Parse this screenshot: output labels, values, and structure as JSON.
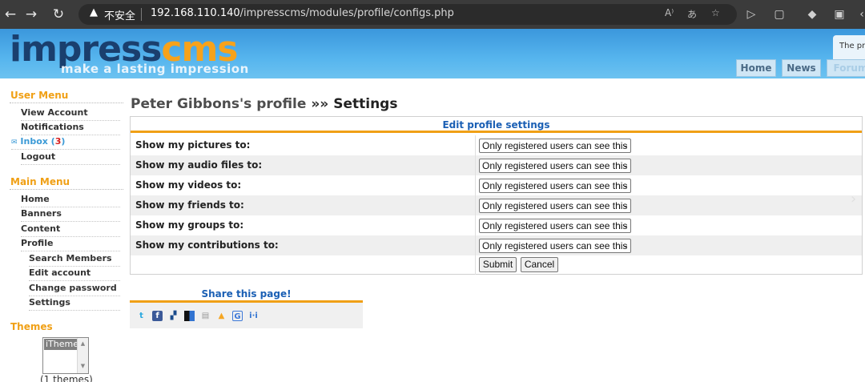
{
  "browser": {
    "security_warning": "不安全",
    "url_host": "192.168.110.140",
    "url_path": "/impresscms/modules/profile/configs.php"
  },
  "header": {
    "logo_part1": "impress",
    "logo_part2": "cms",
    "tagline": "make a lasting impression",
    "tooltip": "The pro",
    "nav_tabs": [
      "Home",
      "News",
      "Forum"
    ]
  },
  "sidebar": {
    "user_menu_title": "User Menu",
    "user_menu": [
      {
        "label": "View Account"
      },
      {
        "label": "Notifications"
      },
      {
        "label": "Inbox",
        "count": "3"
      },
      {
        "label": "Logout"
      }
    ],
    "main_menu_title": "Main Menu",
    "main_menu": [
      {
        "label": "Home"
      },
      {
        "label": "Banners"
      },
      {
        "label": "Content"
      },
      {
        "label": "Profile"
      },
      {
        "label": "Search Members"
      },
      {
        "label": "Edit account"
      },
      {
        "label": "Change password"
      },
      {
        "label": "Settings"
      }
    ],
    "themes_title": "Themes",
    "theme_selected": "iTheme",
    "themes_count": "(1 themes)"
  },
  "main": {
    "title_profile": "Peter Gibbons's profile",
    "title_sep": "»»",
    "title_current": "Settings",
    "table_header": "Edit profile settings",
    "rows": [
      {
        "label": "Show my pictures to:",
        "value": "Only registered users can see this"
      },
      {
        "label": "Show my audio files to:",
        "value": "Only registered users can see this"
      },
      {
        "label": "Show my videos to:",
        "value": "Only registered users can see this"
      },
      {
        "label": "Show my friends to:",
        "value": "Only registered users can see this"
      },
      {
        "label": "Show my groups to:",
        "value": "Only registered users can see this"
      },
      {
        "label": "Show my contributions to:",
        "value": "Only registered users can see this"
      }
    ],
    "submit_label": "Submit",
    "cancel_label": "Cancel"
  },
  "share": {
    "title": "Share this page!",
    "icons": [
      "twitter-icon",
      "facebook-icon",
      "myspace-icon",
      "delicious-icon",
      "digg-icon",
      "stumbleupon-icon",
      "google-icon",
      "hi5-icon"
    ]
  },
  "colors": {
    "accent_orange": "#f0a016",
    "link_blue": "#1a5fb4",
    "header_blue": "#3b97dc",
    "inbox_count_red": "#d62020"
  }
}
